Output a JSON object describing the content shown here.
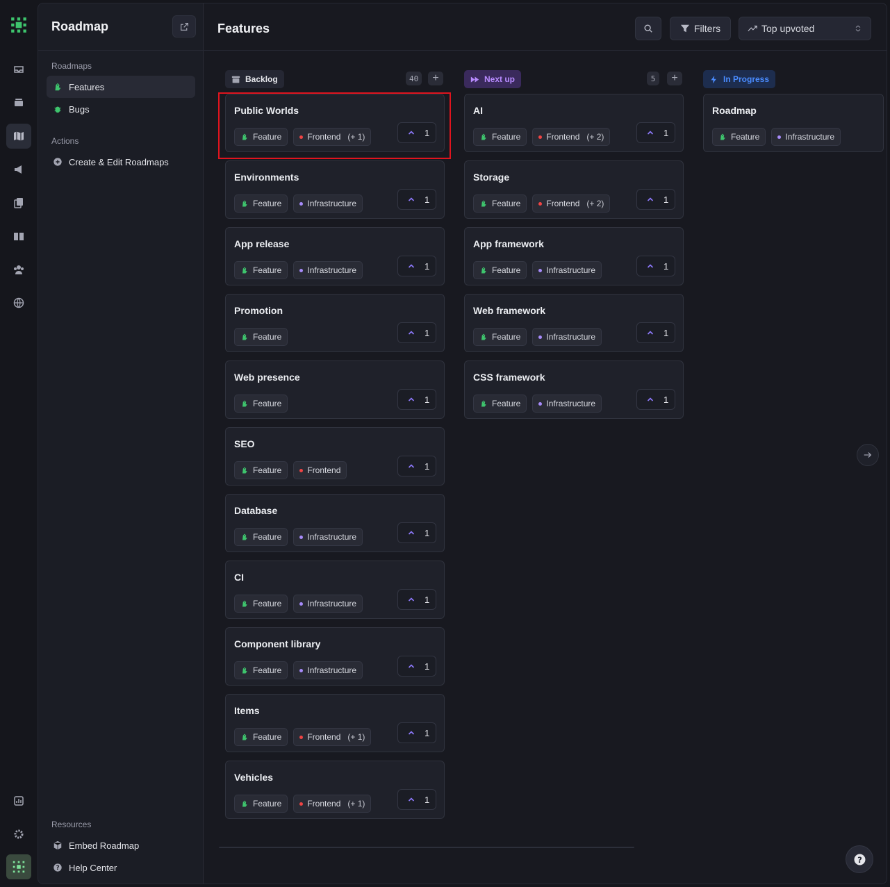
{
  "app": {
    "logo": "roadmap-logo",
    "accent": "#7c5cff"
  },
  "sidebar": {
    "title": "Roadmap",
    "sections": {
      "roadmaps": "Roadmaps",
      "actions": "Actions",
      "resources": "Resources"
    },
    "roadmaps": [
      {
        "label": "Features",
        "icon": "feature-icon",
        "active": true
      },
      {
        "label": "Bugs",
        "icon": "bug-icon",
        "active": false
      }
    ],
    "actions": [
      {
        "label": "Create & Edit Roadmaps",
        "icon": "plus-circle-icon"
      }
    ],
    "resources": [
      {
        "label": "Embed Roadmap",
        "icon": "cube-icon"
      },
      {
        "label": "Help Center",
        "icon": "question-icon"
      }
    ]
  },
  "topbar": {
    "title": "Features",
    "filters_label": "Filters",
    "sort_label": "Top upvoted"
  },
  "columns": [
    {
      "name": "Backlog",
      "count": "40",
      "color": "#c9cbd3",
      "cards": [
        {
          "title": "Public Worlds",
          "tags": [
            {
              "label": "Feature"
            },
            {
              "label": "Frontend",
              "dot": "#ef4444",
              "extra": "(+ 1)"
            }
          ],
          "votes": "1"
        },
        {
          "title": "Environments",
          "tags": [
            {
              "label": "Feature"
            },
            {
              "label": "Infrastructure",
              "dot": "#a78bfa"
            }
          ],
          "votes": "1"
        },
        {
          "title": "App release",
          "tags": [
            {
              "label": "Feature"
            },
            {
              "label": "Infrastructure",
              "dot": "#a78bfa"
            }
          ],
          "votes": "1"
        },
        {
          "title": "Promotion",
          "tags": [
            {
              "label": "Feature"
            }
          ],
          "votes": "1"
        },
        {
          "title": "Web presence",
          "tags": [
            {
              "label": "Feature"
            }
          ],
          "votes": "1"
        },
        {
          "title": "SEO",
          "tags": [
            {
              "label": "Feature"
            },
            {
              "label": "Frontend",
              "dot": "#ef4444"
            }
          ],
          "votes": "1"
        },
        {
          "title": "Database",
          "tags": [
            {
              "label": "Feature"
            },
            {
              "label": "Infrastructure",
              "dot": "#a78bfa"
            }
          ],
          "votes": "1"
        },
        {
          "title": "CI",
          "tags": [
            {
              "label": "Feature"
            },
            {
              "label": "Infrastructure",
              "dot": "#a78bfa"
            }
          ],
          "votes": "1"
        },
        {
          "title": "Component library",
          "tags": [
            {
              "label": "Feature"
            },
            {
              "label": "Infrastructure",
              "dot": "#a78bfa"
            }
          ],
          "votes": "1"
        },
        {
          "title": "Items",
          "tags": [
            {
              "label": "Feature"
            },
            {
              "label": "Frontend",
              "dot": "#ef4444",
              "extra": "(+ 1)"
            }
          ],
          "votes": "1"
        },
        {
          "title": "Vehicles",
          "tags": [
            {
              "label": "Feature"
            },
            {
              "label": "Frontend",
              "dot": "#ef4444",
              "extra": "(+ 1)"
            }
          ],
          "votes": "1"
        }
      ]
    },
    {
      "name": "Next up",
      "count": "5",
      "color": "#b07cff",
      "cards": [
        {
          "title": "AI",
          "tags": [
            {
              "label": "Feature"
            },
            {
              "label": "Frontend",
              "dot": "#ef4444",
              "extra": "(+ 2)"
            }
          ],
          "votes": "1"
        },
        {
          "title": "Storage",
          "tags": [
            {
              "label": "Feature"
            },
            {
              "label": "Frontend",
              "dot": "#ef4444",
              "extra": "(+ 2)"
            }
          ],
          "votes": "1"
        },
        {
          "title": "App framework",
          "tags": [
            {
              "label": "Feature"
            },
            {
              "label": "Infrastructure",
              "dot": "#a78bfa"
            }
          ],
          "votes": "1"
        },
        {
          "title": "Web framework",
          "tags": [
            {
              "label": "Feature"
            },
            {
              "label": "Infrastructure",
              "dot": "#a78bfa"
            }
          ],
          "votes": "1"
        },
        {
          "title": "CSS framework",
          "tags": [
            {
              "label": "Feature"
            },
            {
              "label": "Infrastructure",
              "dot": "#a78bfa"
            }
          ],
          "votes": "1"
        }
      ]
    },
    {
      "name": "In Progress",
      "count": "",
      "color": "#3b82f6",
      "cards": [
        {
          "title": "Roadmap",
          "tags": [
            {
              "label": "Feature"
            },
            {
              "label": "Infrastructure",
              "dot": "#a78bfa"
            }
          ],
          "votes": ""
        }
      ]
    }
  ]
}
